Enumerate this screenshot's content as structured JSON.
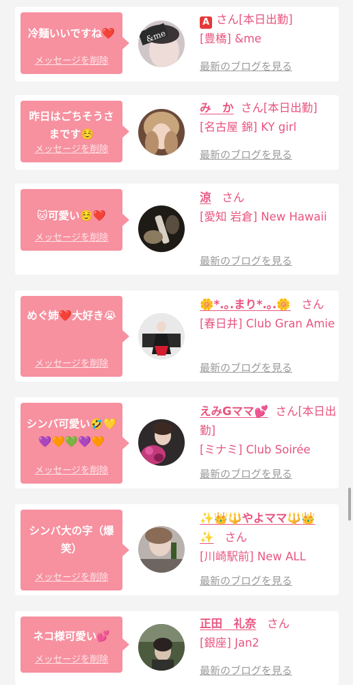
{
  "delete_label": "メッセージを削除",
  "blog_label": "最新のブログを見る",
  "colors": {
    "background": "#f4f4f5",
    "bubble": "#f7909f",
    "accent_text": "#e8547f",
    "link_gray": "#9a9a9a"
  },
  "cards": [
    {
      "message": "冷麺いいですね❤️",
      "name_prefix": "🅰️",
      "name": "",
      "honorific": "さん[本日出勤]",
      "location": "[豊橋] &me",
      "avatar_text": "&me"
    },
    {
      "message": "昨日はごちそうさまです☺️",
      "name": "み　か",
      "honorific": "さん[本日出勤]",
      "location": "[名古屋 錦] KY girl"
    },
    {
      "message": "🐱可愛い☺️❤️",
      "name": "涼",
      "honorific": "さん",
      "location": "[愛知 岩倉] New Hawaii"
    },
    {
      "message": "めぐ姉❤️大好き😭",
      "name": "🌼*.｡.まり*.｡.🌼",
      "honorific": "さん",
      "location": "[春日井] Club Gran Amie"
    },
    {
      "message": "シンバ可愛い🤣💛💜🧡💚💜🧡",
      "name": "えみGママ💕",
      "honorific": "さん[本日出勤]",
      "location": "[ミナミ] Club Soirée"
    },
    {
      "message": "シンバ大の字（爆笑）",
      "name": "✨👑🔱やよママ🔱👑✨",
      "honorific": "さん",
      "location": "[川崎駅前] New ALL"
    },
    {
      "message": "ネコ様可愛い💕",
      "name": "正田　礼奈",
      "honorific": "さん",
      "location": "[銀座] Jan2"
    }
  ]
}
